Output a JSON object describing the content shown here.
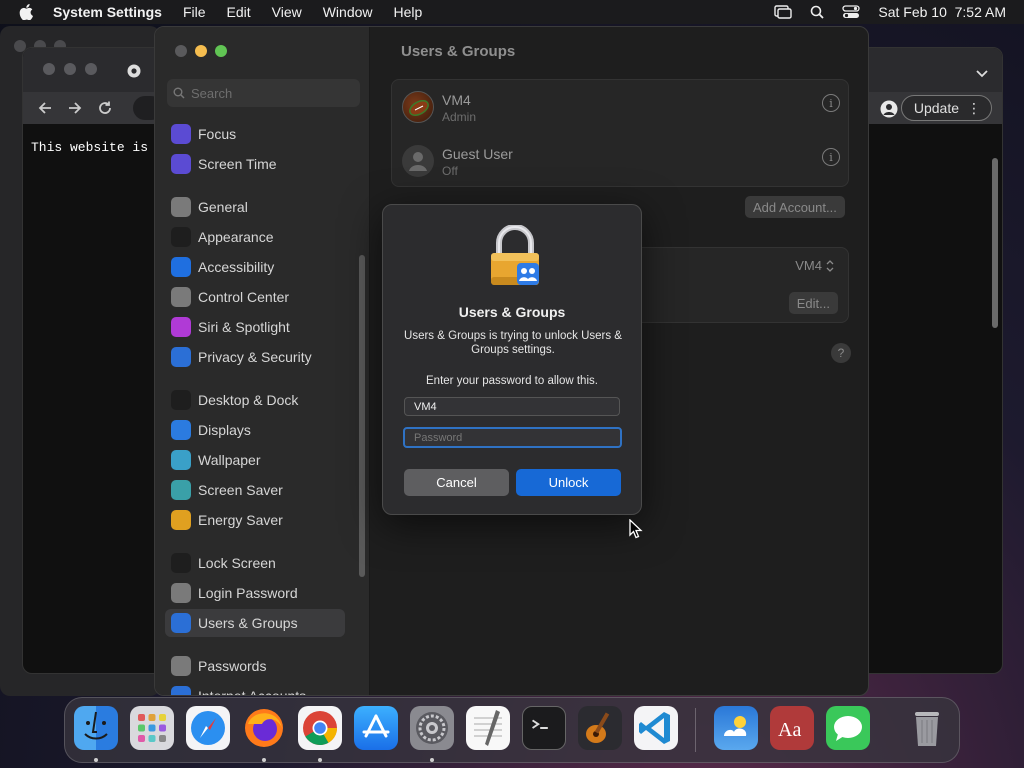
{
  "menubar": {
    "app_name": "System Settings",
    "items": [
      "File",
      "Edit",
      "View",
      "Window",
      "Help"
    ],
    "datetime": "Sat Feb 10  7:52 AM"
  },
  "browser": {
    "update_label": "Update",
    "page_text": "This website is"
  },
  "settings": {
    "search_placeholder": "Search",
    "sidebar": [
      {
        "label": "Focus",
        "icon": "moon-icon",
        "color": "#5b4bd3"
      },
      {
        "label": "Screen Time",
        "icon": "hourglass-icon",
        "color": "#5b4bd3"
      },
      {
        "label": "General",
        "icon": "gear-icon",
        "color": "#7a7a7a"
      },
      {
        "label": "Appearance",
        "icon": "appearance-icon",
        "color": "#1e1e1e"
      },
      {
        "label": "Accessibility",
        "icon": "accessibility-icon",
        "color": "#1f6fe0"
      },
      {
        "label": "Control Center",
        "icon": "control-center-icon",
        "color": "#7a7a7a"
      },
      {
        "label": "Siri & Spotlight",
        "icon": "siri-icon",
        "color": "#b03ad6"
      },
      {
        "label": "Privacy & Security",
        "icon": "hand-icon",
        "color": "#2b6fd6"
      },
      {
        "label": "Desktop & Dock",
        "icon": "dock-icon",
        "color": "#1e1e1e"
      },
      {
        "label": "Displays",
        "icon": "sun-icon",
        "color": "#2b7be0"
      },
      {
        "label": "Wallpaper",
        "icon": "wallpaper-icon",
        "color": "#3aa0c8"
      },
      {
        "label": "Screen Saver",
        "icon": "screen-saver-icon",
        "color": "#3aa0a8"
      },
      {
        "label": "Energy Saver",
        "icon": "battery-icon",
        "color": "#e0a020"
      },
      {
        "label": "Lock Screen",
        "icon": "lock-icon",
        "color": "#1e1e1e"
      },
      {
        "label": "Login Password",
        "icon": "padlock-icon",
        "color": "#7a7a7a"
      },
      {
        "label": "Users & Groups",
        "icon": "users-icon",
        "color": "#2b6fd6"
      },
      {
        "label": "Passwords",
        "icon": "key-icon",
        "color": "#7a7a7a"
      },
      {
        "label": "Internet Accounts",
        "icon": "at-icon",
        "color": "#2b6fd6"
      }
    ],
    "main_title": "Users & Groups",
    "users": [
      {
        "name": "VM4",
        "role": "Admin"
      },
      {
        "name": "Guest User",
        "role": "Off"
      }
    ],
    "add_account_label": "Add Account...",
    "auto_login_value": "VM4",
    "edit_label": "Edit...",
    "help_label": "?"
  },
  "dialog": {
    "title": "Users & Groups",
    "message": "Users & Groups is trying to unlock Users & Groups settings.",
    "prompt": "Enter your password to allow this.",
    "username": "VM4",
    "password_placeholder": "Password",
    "cancel_label": "Cancel",
    "unlock_label": "Unlock"
  },
  "dock": {
    "apps": [
      "finder-icon",
      "launchpad-icon",
      "safari-icon",
      "firefox-icon",
      "chrome-icon",
      "app-store-icon",
      "system-settings-icon",
      "textedit-icon",
      "terminal-icon",
      "garageband-icon",
      "vscode-icon",
      "weather-icon",
      "dictionary-icon",
      "messages-icon",
      "trash-icon"
    ]
  }
}
